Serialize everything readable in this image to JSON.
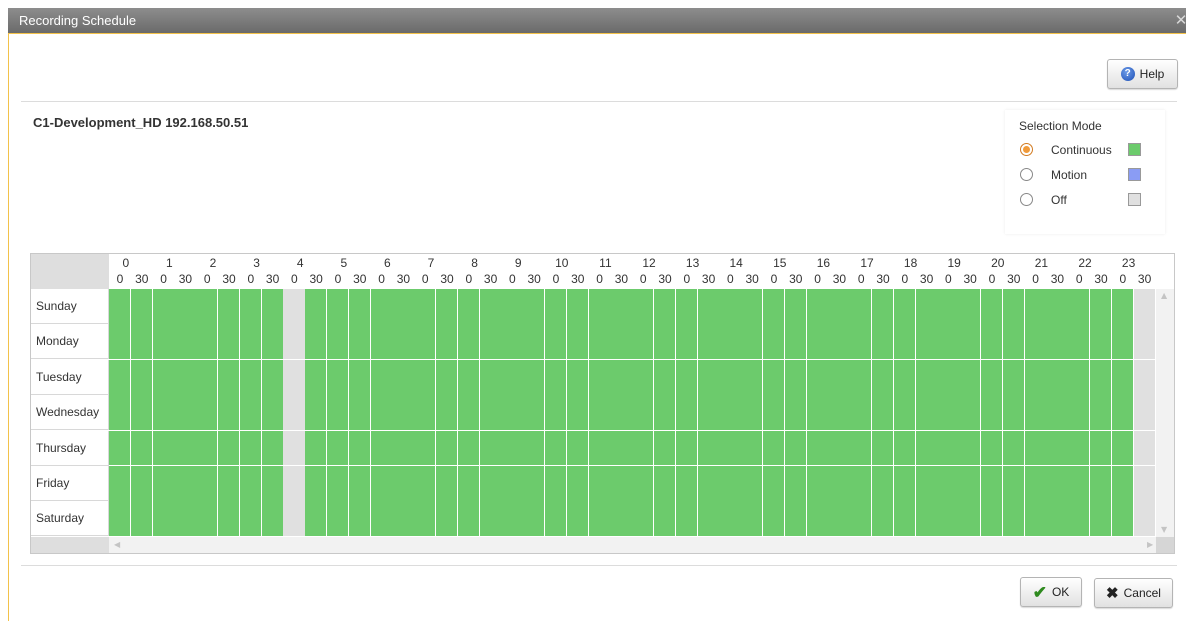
{
  "window": {
    "title": "Recording Schedule",
    "close_glyph": "✕"
  },
  "toolbar": {
    "help_label": "Help",
    "help_icon": "help-icon"
  },
  "camera": {
    "title": "C1-Development_HD 192.168.50.51"
  },
  "selection_mode": {
    "title": "Selection Mode",
    "selected": "Continuous",
    "options": [
      {
        "label": "Continuous",
        "color": "#6ccb6c",
        "selected": true
      },
      {
        "label": "Motion",
        "color": "#8a9cf4",
        "selected": false
      },
      {
        "label": "Off",
        "color": "#e0e0e0",
        "selected": false
      }
    ]
  },
  "schedule": {
    "hours": [
      "0",
      "1",
      "2",
      "3",
      "4",
      "5",
      "6",
      "7",
      "8",
      "9",
      "10",
      "11",
      "12",
      "13",
      "14",
      "15",
      "16",
      "17",
      "18",
      "19",
      "20",
      "21",
      "22",
      "23"
    ],
    "half_labels": [
      "0",
      "30"
    ],
    "days": [
      "Sunday",
      "Monday",
      "Tuesday",
      "Wednesday",
      "Thursday",
      "Friday",
      "Saturday"
    ],
    "mode_colors": {
      "continuous": "#6ccb6c",
      "motion": "#8a9cf4",
      "off": "#e0e0e0"
    },
    "off_slots": [
      8,
      47
    ],
    "default_mode": "continuous"
  },
  "footer": {
    "ok_label": "OK",
    "cancel_label": "Cancel"
  }
}
